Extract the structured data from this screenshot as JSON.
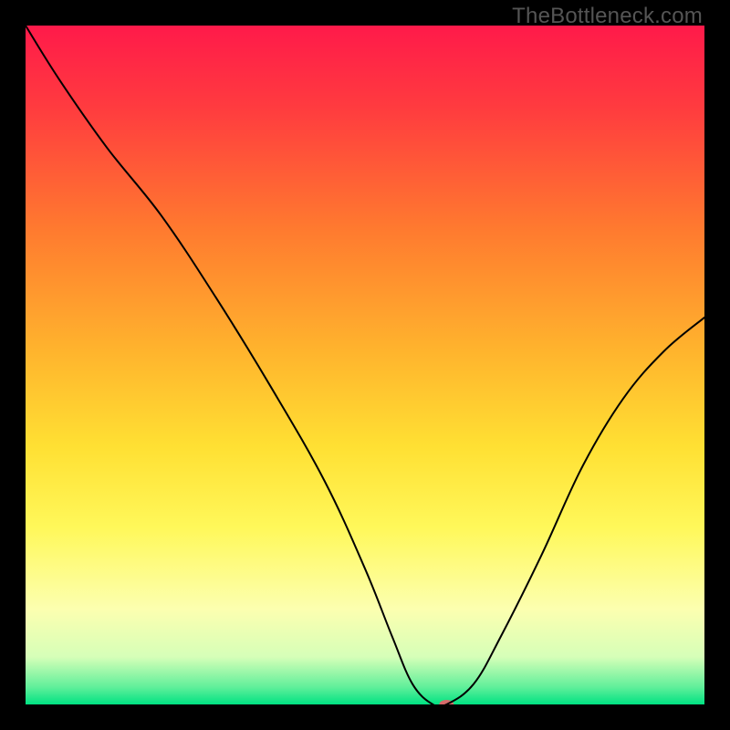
{
  "watermark": "TheBottleneck.com",
  "chart_data": {
    "type": "line",
    "title": "",
    "xlabel": "",
    "ylabel": "",
    "xlim": [
      0,
      100
    ],
    "ylim": [
      0,
      100
    ],
    "grid": false,
    "legend": false,
    "background": {
      "type": "vertical-gradient",
      "description": "Red at top through orange, yellow, pale yellow, to green at the very bottom",
      "stops": [
        {
          "pos": 0,
          "color": "#ff1a4a"
        },
        {
          "pos": 12,
          "color": "#ff3b3f"
        },
        {
          "pos": 30,
          "color": "#ff7a2f"
        },
        {
          "pos": 48,
          "color": "#ffb42d"
        },
        {
          "pos": 62,
          "color": "#ffe033"
        },
        {
          "pos": 74,
          "color": "#fff85a"
        },
        {
          "pos": 86,
          "color": "#fcffb0"
        },
        {
          "pos": 93,
          "color": "#d6ffb8"
        },
        {
          "pos": 97.5,
          "color": "#5fef9a"
        },
        {
          "pos": 100,
          "color": "#00e282"
        }
      ]
    },
    "series": [
      {
        "name": "bottleneck-curve",
        "color": "#000000",
        "stroke_width": 2,
        "x": [
          0,
          5,
          12,
          20,
          28,
          36,
          44,
          50,
          54,
          57,
          60,
          62,
          66,
          70,
          76,
          82,
          88,
          94,
          100
        ],
        "y": [
          100,
          92,
          82,
          72,
          60,
          47,
          33,
          20,
          10,
          3,
          0,
          0,
          3,
          10,
          22,
          35,
          45,
          52,
          57
        ]
      }
    ],
    "marker": {
      "name": "optimum-marker",
      "x": 62,
      "y": 0,
      "color": "#d66a6a",
      "rx": 8,
      "ry": 5
    }
  }
}
